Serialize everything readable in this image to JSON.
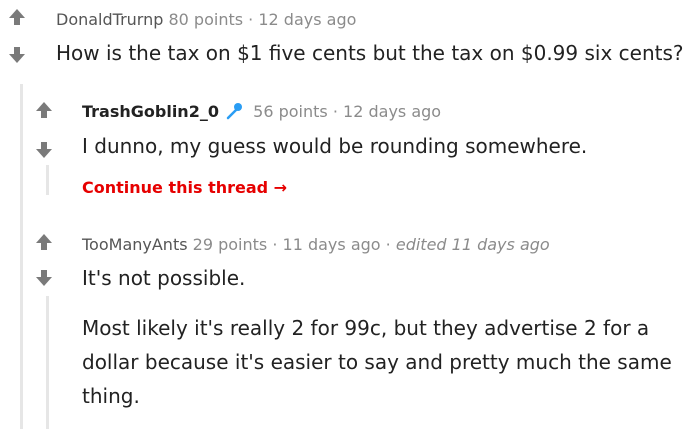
{
  "comments": [
    {
      "author": "DonaldTrurnp",
      "points": "80 points",
      "time": "12 days ago",
      "body": "How is the tax on $1 five cents but the tax on $0.99 six cents?"
    },
    {
      "author": "TrashGoblin2_0",
      "points": "56 points",
      "time": "12 days ago",
      "body": "I dunno, my guess would be rounding somewhere.",
      "continue_label": "Continue this thread →"
    },
    {
      "author": "TooManyAnts",
      "points": "29 points",
      "time": "11 days ago",
      "edited": "edited 11 days ago",
      "body_paragraphs": [
        "It's not possible.",
        "Most likely it's really 2 for 99c, but they advertise 2 for a dollar because it's easier to say and pretty much the same thing."
      ]
    }
  ],
  "separator": "·",
  "colors": {
    "vote_arrow": "#7a7a7a",
    "meta_text": "#8b8b8b",
    "continue_link": "#e60000",
    "flair_icon": "#2a9df4",
    "thread_line": "#e6e6e6"
  },
  "icons": {
    "upvote": "arrow-up-icon",
    "downvote": "arrow-down-icon",
    "flair": "microphone-icon"
  }
}
